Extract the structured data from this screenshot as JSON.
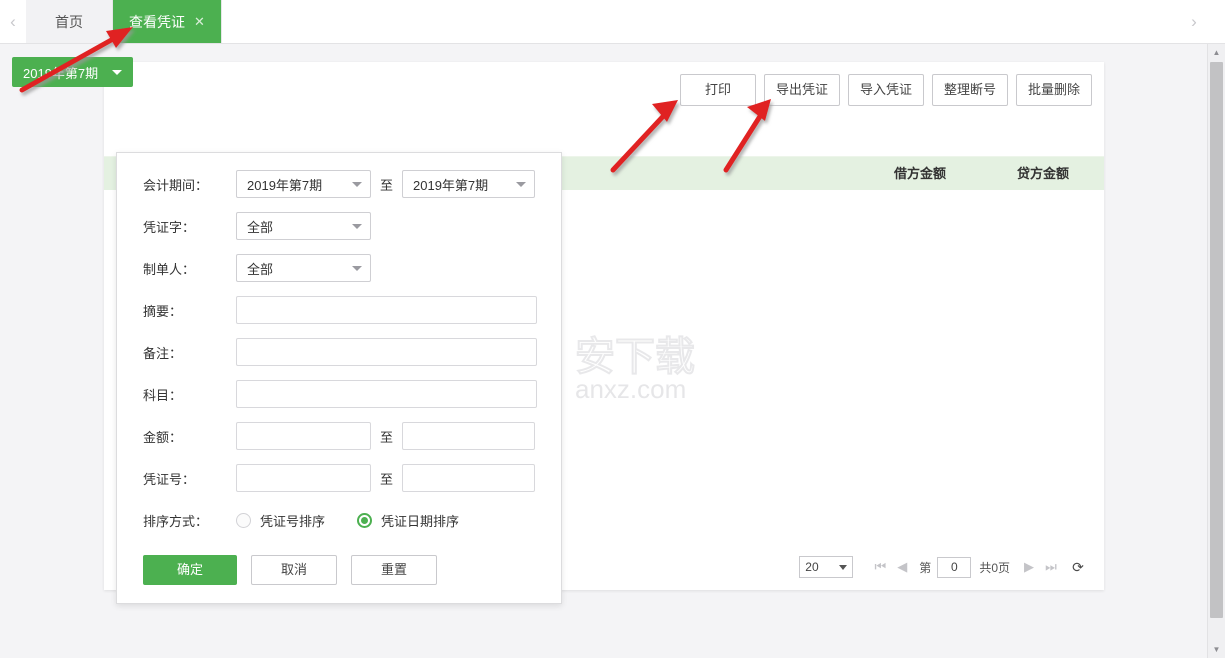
{
  "tabbar": {
    "prev_icon": "chevron-left-icon",
    "next_icon": "chevron-right-icon",
    "tabs": [
      {
        "label": "首页",
        "active": false
      },
      {
        "label": "查看凭证",
        "active": true,
        "close_icon": "close-icon"
      }
    ],
    "close_glyph": "✕"
  },
  "period_button": {
    "label": "2019年第7期",
    "caret_icon": "caret-down-icon"
  },
  "toolbar": {
    "buttons": [
      {
        "label": "打印"
      },
      {
        "label": "导出凭证"
      },
      {
        "label": "导入凭证"
      },
      {
        "label": "整理断号"
      },
      {
        "label": "批量删除"
      }
    ]
  },
  "table": {
    "columns": [
      {
        "key": "debit",
        "label": "借方金额"
      },
      {
        "key": "credit",
        "label": "贷方金额"
      }
    ],
    "rows": []
  },
  "pager": {
    "page_size": "20",
    "page_size_caret": "caret-down-icon",
    "first_icon": "first-page-icon",
    "prev_icon": "prev-page-icon",
    "page_prefix": "第",
    "page_number": "0",
    "total_text": "共0页",
    "next_icon": "next-page-icon",
    "last_icon": "last-page-icon",
    "refresh_icon": "refresh-icon",
    "refresh_glyph": "⟳"
  },
  "filter_panel": {
    "fields": {
      "period": {
        "label": "会计期间：",
        "from_value": "2019年第7期",
        "between": "至",
        "to_value": "2019年第7期"
      },
      "voucher_word": {
        "label": "凭证字：",
        "value": "全部"
      },
      "maker": {
        "label": "制单人：",
        "value": "全部"
      },
      "summary": {
        "label": "摘要：",
        "value": "",
        "placeholder": ""
      },
      "remark": {
        "label": "备注：",
        "value": "",
        "placeholder": ""
      },
      "subject": {
        "label": "科目：",
        "value": "",
        "placeholder": ""
      },
      "amount": {
        "label": "金额：",
        "from_value": "",
        "between": "至",
        "to_value": ""
      },
      "voucher_no": {
        "label": "凭证号：",
        "from_value": "",
        "between": "至",
        "to_value": ""
      },
      "sort": {
        "label": "排序方式：",
        "options": [
          {
            "label": "凭证号排序",
            "selected": false
          },
          {
            "label": "凭证日期排序",
            "selected": true
          }
        ]
      }
    },
    "actions": [
      {
        "label": "确定",
        "kind": "primary"
      },
      {
        "label": "取消",
        "kind": "ghost"
      },
      {
        "label": "重置",
        "kind": "ghost"
      }
    ]
  },
  "watermark": {
    "text_cn": "安下载",
    "text_en": "anxz.com",
    "logo_icon": "bag-lock-icon"
  },
  "scrollbar": {
    "up_icon": "triangle-up-icon",
    "down_icon": "triangle-down-icon",
    "thumb": "scrollbar-thumb"
  },
  "annotations": {
    "arrow_color": "#e02020",
    "count": 3
  },
  "colors": {
    "accent_green": "#4cb050",
    "table_header_green": "#e4f1e1",
    "page_background": "#f4f4f6",
    "arrow_red": "#e02020"
  }
}
